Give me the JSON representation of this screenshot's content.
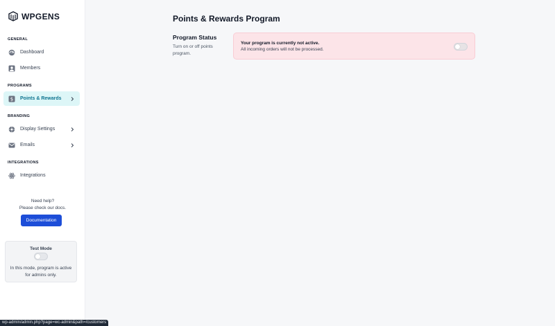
{
  "brand": {
    "name": "WPGENS"
  },
  "sidebar": {
    "sections": {
      "general": "GENERAL",
      "programs": "PROGRAMS",
      "branding": "BRANDING",
      "integrations": "INTEGRATIONS"
    },
    "items": [
      {
        "label": "Dashboard",
        "icon": "dashboard-icon",
        "active": false,
        "has_chevron": false
      },
      {
        "label": "Members",
        "icon": "members-icon",
        "active": false,
        "has_chevron": false
      },
      {
        "label": "Points & Rewards",
        "icon": "points-rewards-icon",
        "active": true,
        "has_chevron": true
      },
      {
        "label": "Display Settings",
        "icon": "display-settings-icon",
        "active": false,
        "has_chevron": true
      },
      {
        "label": "Emails",
        "icon": "email-icon",
        "active": false,
        "has_chevron": true
      },
      {
        "label": "Integrations",
        "icon": "integrations-icon",
        "active": false,
        "has_chevron": false
      }
    ],
    "help_line1": "Need help?",
    "help_line2": "Please check our docs.",
    "docs_button": "Documentation",
    "test_mode": {
      "title": "Test Mode",
      "enabled": false,
      "desc_line1": "In this mode, program is active",
      "desc_line2": "for admins only."
    }
  },
  "main": {
    "title": "Points & Rewards Program",
    "program_status": {
      "title": "Program Status",
      "desc_line1": "Turn on or off points",
      "desc_line2": "program.",
      "alert_title": "Your program is currently not active.",
      "alert_desc": "All incoming orders will not be processed.",
      "enabled": false
    }
  },
  "statusbar": {
    "url": "wp-admin/admin.php?page=wc-admin&path=/customers"
  },
  "colors": {
    "accent": "#1d4ed8",
    "active_bg": "#ddf6f7",
    "active_text": "#0e7490",
    "alert_bg": "#fce4e8"
  }
}
